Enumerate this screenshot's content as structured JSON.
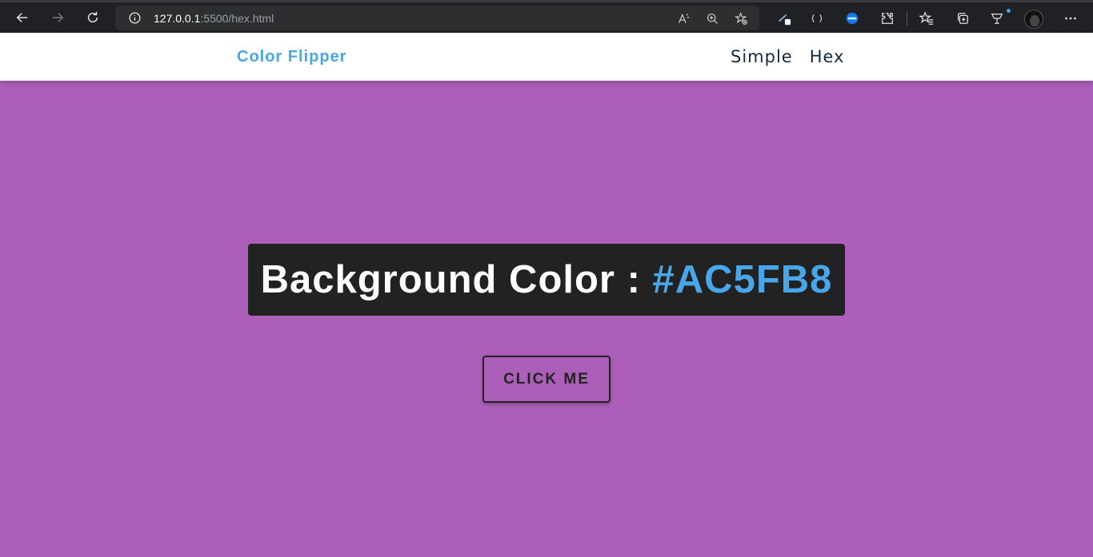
{
  "browser": {
    "url_host": "127.0.0.1",
    "url_rest": ":5500/hex.html"
  },
  "navbar": {
    "brand": "Color Flipper",
    "links": [
      "Simple",
      "Hex"
    ]
  },
  "main": {
    "heading_prefix": "Background Color : ",
    "color_value": "#AC5FB8",
    "button_label": "click me"
  },
  "colors": {
    "background": "#ac5fb8",
    "accent": "#49a6e9",
    "dark": "#222222",
    "nav_text": "#102a42"
  }
}
